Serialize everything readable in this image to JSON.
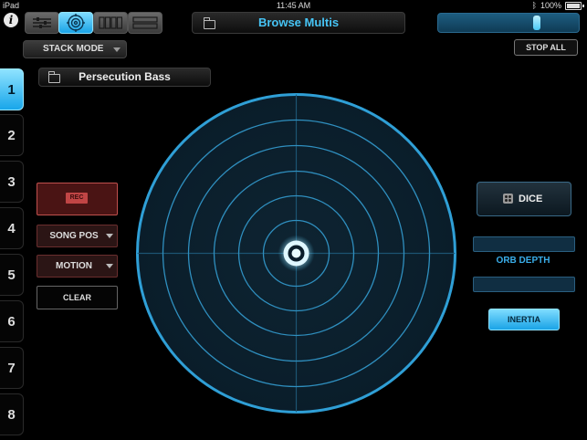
{
  "status_bar": {
    "device": "iPad",
    "time": "11:45 AM",
    "battery": "100%"
  },
  "toolbar": {
    "info_label": "i",
    "browse_label": "Browse Multis",
    "stop_all_label": "STOP ALL",
    "stack_mode_label": "STACK MODE",
    "volume_level": 0.72
  },
  "parts": {
    "selected": "1",
    "items": [
      {
        "label": "1"
      },
      {
        "label": "2"
      },
      {
        "label": "3"
      },
      {
        "label": "4"
      },
      {
        "label": "5"
      },
      {
        "label": "6"
      },
      {
        "label": "7"
      },
      {
        "label": "8"
      }
    ]
  },
  "patch": {
    "name": "Persecution Bass"
  },
  "left_controls": {
    "rec_label": "REC",
    "song_pos_label": "SONG POS",
    "motion_label": "MOTION",
    "clear_label": "CLEAR"
  },
  "right_controls": {
    "dice_label": "DICE",
    "orb_depth_label": "ORB DEPTH",
    "inertia_label": "INERTIA"
  },
  "icons": {
    "info": "info-icon",
    "folder": "folder-icon",
    "dice": "dice-icon",
    "mode_mixer": "sliders-icon",
    "mode_orb": "target-icon",
    "mode_pads": "pads-icon",
    "mode_stack": "stack-icon"
  },
  "colors": {
    "accent": "#46c4f5",
    "orb_ring": "#2f9fd6",
    "rec": "#c0504d"
  }
}
